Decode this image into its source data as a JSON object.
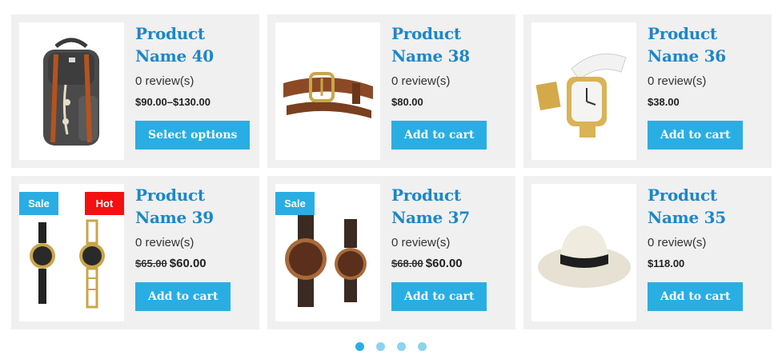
{
  "products": [
    {
      "title": "Product Name 40",
      "reviews": "0 review(s)",
      "price": "$90.00–$130.00",
      "old_price": "",
      "new_price": "",
      "button": "Select options",
      "badges": [],
      "icon": "backpack-icon"
    },
    {
      "title": "Product Name 38",
      "reviews": "0 review(s)",
      "price": "$80.00",
      "old_price": "",
      "new_price": "",
      "button": "Add to cart",
      "badges": [],
      "icon": "belt-icon"
    },
    {
      "title": "Product Name 36",
      "reviews": "0 review(s)",
      "price": "$38.00",
      "old_price": "",
      "new_price": "",
      "button": "Add to cart",
      "badges": [],
      "icon": "gold-watch-icon"
    },
    {
      "title": "Product Name 39",
      "reviews": "0 review(s)",
      "price": "",
      "old_price": "$65.00",
      "new_price": "$60.00",
      "button": "Add to cart",
      "badges": [
        "Sale",
        "Hot"
      ],
      "icon": "watch-pair-icon"
    },
    {
      "title": "Product Name 37",
      "reviews": "0 review(s)",
      "price": "",
      "old_price": "$68.00",
      "new_price": "$60.00",
      "button": "Add to cart",
      "badges": [
        "Sale"
      ],
      "icon": "brown-watches-icon"
    },
    {
      "title": "Product Name 35",
      "reviews": "0 review(s)",
      "price": "$118.00",
      "old_price": "",
      "new_price": "",
      "button": "Add to cart",
      "badges": [],
      "icon": "hat-icon"
    }
  ],
  "pagination": {
    "count": 4,
    "active": 0
  },
  "colors": {
    "accent": "#29aee3",
    "title": "#1c87c9",
    "hot": "#f41010",
    "card_bg": "#f0f0f0"
  }
}
